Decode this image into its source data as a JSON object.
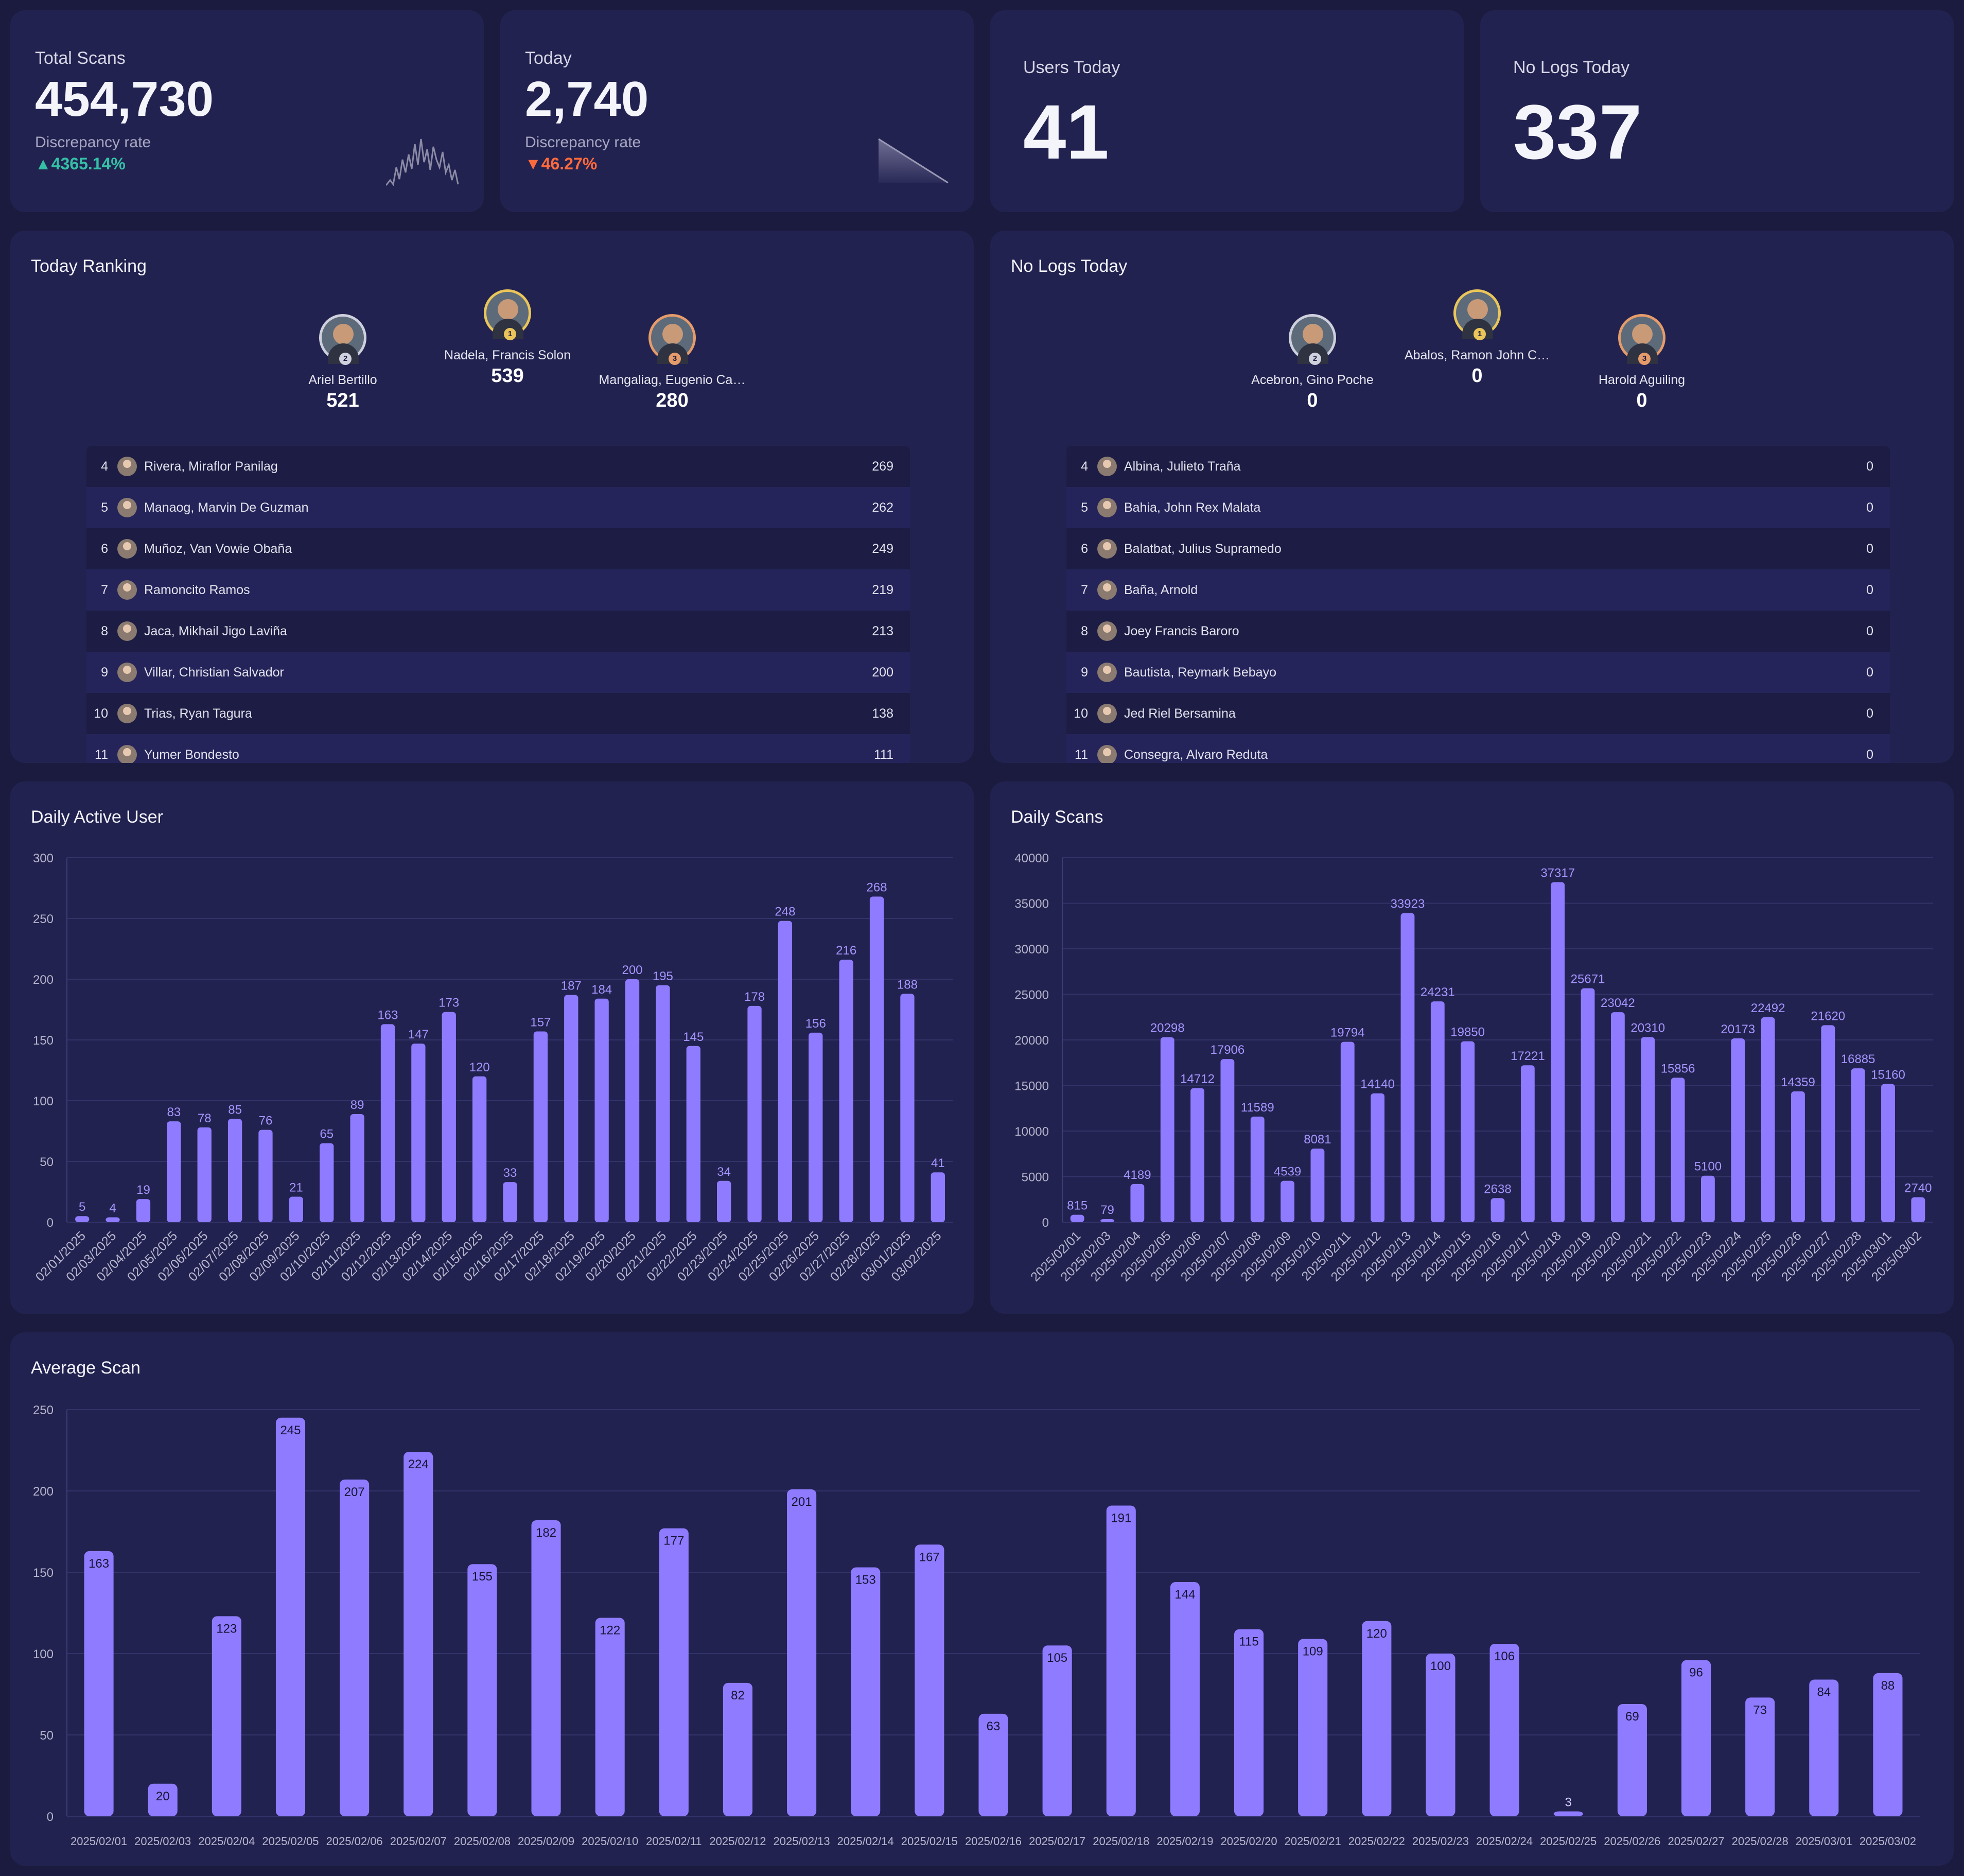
{
  "stats": {
    "total": {
      "label": "Total Scans",
      "value": "454,730",
      "disc_label": "Discrepancy rate",
      "disc_value": "4365.14%",
      "trend": "up"
    },
    "today": {
      "label": "Today",
      "value": "2,740",
      "disc_label": "Discrepancy rate",
      "disc_value": "46.27%",
      "trend": "down"
    },
    "users_today": {
      "label": "Users Today",
      "value": "41"
    },
    "no_logs": {
      "label": "No Logs Today",
      "value": "337"
    }
  },
  "ranking": {
    "title": "Today Ranking",
    "podium": [
      {
        "place": "2",
        "name": "Ariel Bertillo",
        "score": "521"
      },
      {
        "place": "1",
        "name": "Nadela, Francis Solon",
        "score": "539"
      },
      {
        "place": "3",
        "name": "Mangaliag, Eugenio Ca…",
        "score": "280"
      }
    ],
    "rows": [
      {
        "rank": "4",
        "name": "Rivera, Miraflor Panilag",
        "score": "269"
      },
      {
        "rank": "5",
        "name": "Manaog, Marvin De Guzman",
        "score": "262"
      },
      {
        "rank": "6",
        "name": "Muñoz, Van Vowie Obaña",
        "score": "249"
      },
      {
        "rank": "7",
        "name": "Ramoncito Ramos",
        "score": "219"
      },
      {
        "rank": "8",
        "name": "Jaca, Mikhail Jigo Laviña",
        "score": "213"
      },
      {
        "rank": "9",
        "name": "Villar, Christian Salvador",
        "score": "200"
      },
      {
        "rank": "10",
        "name": "Trias, Ryan Tagura",
        "score": "138"
      },
      {
        "rank": "11",
        "name": "Yumer Bondesto",
        "score": "111"
      }
    ]
  },
  "nologs": {
    "title": "No Logs Today",
    "podium": [
      {
        "place": "2",
        "name": "Acebron, Gino Poche",
        "score": "0"
      },
      {
        "place": "1",
        "name": "Abalos, Ramon John C…",
        "score": "0"
      },
      {
        "place": "3",
        "name": "Harold Aguiling",
        "score": "0"
      }
    ],
    "rows": [
      {
        "rank": "4",
        "name": "Albina, Julieto Traña",
        "score": "0"
      },
      {
        "rank": "5",
        "name": "Bahia, John Rex Malata",
        "score": "0"
      },
      {
        "rank": "6",
        "name": "Balatbat, Julius Supramedo",
        "score": "0"
      },
      {
        "rank": "7",
        "name": "Baña, Arnold",
        "score": "0"
      },
      {
        "rank": "8",
        "name": "Joey Francis Baroro",
        "score": "0"
      },
      {
        "rank": "9",
        "name": "Bautista, Reymark Bebayo",
        "score": "0"
      },
      {
        "rank": "10",
        "name": "Jed Riel Bersamina",
        "score": "0"
      },
      {
        "rank": "11",
        "name": "Consegra, Alvaro Reduta",
        "score": "0"
      }
    ]
  },
  "colors": {
    "bar": "#8f7bff",
    "up": "#35c0a6",
    "down": "#ff6a3d"
  },
  "chart_data": [
    {
      "id": "dau",
      "type": "bar",
      "title": "Daily Active User",
      "categories": [
        "02/01/2025",
        "02/03/2025",
        "02/04/2025",
        "02/05/2025",
        "02/06/2025",
        "02/07/2025",
        "02/08/2025",
        "02/09/2025",
        "02/10/2025",
        "02/11/2025",
        "02/12/2025",
        "02/13/2025",
        "02/14/2025",
        "02/15/2025",
        "02/16/2025",
        "02/17/2025",
        "02/18/2025",
        "02/19/2025",
        "02/20/2025",
        "02/21/2025",
        "02/22/2025",
        "02/23/2025",
        "02/24/2025",
        "02/25/2025",
        "02/26/2025",
        "02/27/2025",
        "02/28/2025",
        "03/01/2025",
        "03/02/2025"
      ],
      "values": [
        5,
        4,
        19,
        83,
        78,
        85,
        76,
        21,
        65,
        89,
        163,
        147,
        173,
        120,
        33,
        157,
        187,
        184,
        200,
        195,
        145,
        34,
        178,
        248,
        156,
        216,
        268,
        188,
        41
      ],
      "ylim": [
        0,
        300
      ],
      "yticks": [
        0,
        50,
        100,
        150,
        200,
        250,
        300
      ],
      "grid": true
    },
    {
      "id": "scans",
      "type": "bar",
      "title": "Daily Scans",
      "categories": [
        "2025/02/01",
        "2025/02/03",
        "2025/02/04",
        "2025/02/05",
        "2025/02/06",
        "2025/02/07",
        "2025/02/08",
        "2025/02/09",
        "2025/02/10",
        "2025/02/11",
        "2025/02/12",
        "2025/02/13",
        "2025/02/14",
        "2025/02/15",
        "2025/02/16",
        "2025/02/17",
        "2025/02/18",
        "2025/02/19",
        "2025/02/20",
        "2025/02/21",
        "2025/02/22",
        "2025/02/23",
        "2025/02/24",
        "2025/02/25",
        "2025/02/26",
        "2025/02/27",
        "2025/02/28",
        "2025/03/01",
        "2025/03/02"
      ],
      "values": [
        815,
        79,
        4189,
        20298,
        14712,
        17906,
        11589,
        4539,
        8081,
        19794,
        14140,
        33923,
        24231,
        19850,
        2638,
        17221,
        37317,
        25671,
        23042,
        20310,
        15856,
        5100,
        20173,
        22492,
        14359,
        21620,
        16885,
        15160,
        2740
      ],
      "ylim": [
        0,
        40000
      ],
      "yticks": [
        0,
        5000,
        10000,
        15000,
        20000,
        25000,
        30000,
        35000,
        40000
      ],
      "grid": true
    },
    {
      "id": "avg",
      "type": "bar",
      "title": "Average Scan",
      "categories": [
        "2025/02/01",
        "2025/02/03",
        "2025/02/04",
        "2025/02/05",
        "2025/02/06",
        "2025/02/07",
        "2025/02/08",
        "2025/02/09",
        "2025/02/10",
        "2025/02/11",
        "2025/02/12",
        "2025/02/13",
        "2025/02/14",
        "2025/02/15",
        "2025/02/16",
        "2025/02/17",
        "2025/02/18",
        "2025/02/19",
        "2025/02/20",
        "2025/02/21",
        "2025/02/22",
        "2025/02/23",
        "2025/02/24",
        "2025/02/25",
        "2025/02/26",
        "2025/02/27",
        "2025/02/28",
        "2025/03/01",
        "2025/03/02"
      ],
      "values": [
        163,
        20,
        123,
        245,
        207,
        224,
        155,
        182,
        122,
        177,
        82,
        201,
        153,
        167,
        63,
        105,
        191,
        144,
        115,
        109,
        120,
        100,
        106,
        3,
        69,
        96,
        73,
        84,
        88
      ],
      "ylim": [
        0,
        250
      ],
      "yticks": [
        0,
        50,
        100,
        150,
        200,
        250
      ],
      "grid": true
    }
  ]
}
